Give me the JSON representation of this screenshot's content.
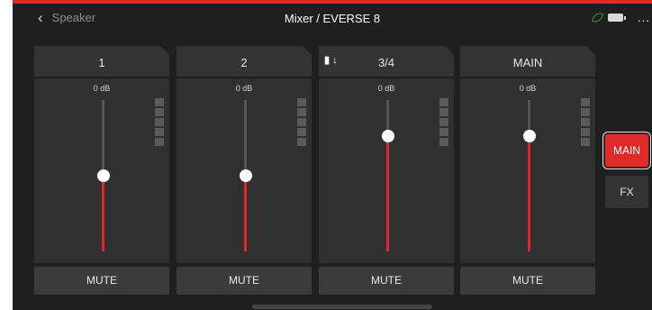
{
  "header": {
    "back_label": "Speaker",
    "title": "Mixer / EVERSE 8",
    "more_label": "..."
  },
  "channels": [
    {
      "label": "1",
      "gain": "0 dB",
      "fader_level": 0.5,
      "mute_label": "MUTE"
    },
    {
      "label": "2",
      "gain": "0 dB",
      "fader_level": 0.5,
      "mute_label": "MUTE"
    },
    {
      "label": "3/4",
      "gain": "0 dB",
      "fader_level": 0.76,
      "mute_label": "MUTE",
      "input_icons": "▮ ↓"
    },
    {
      "label": "MAIN",
      "gain": "0 dB",
      "fader_level": 0.76,
      "mute_label": "MUTE"
    }
  ],
  "side_tabs": [
    {
      "label": "MAIN",
      "active": true
    },
    {
      "label": "FX",
      "active": false
    }
  ],
  "colors": {
    "accent": "#e02a2a",
    "background": "#1f1f1f",
    "panel": "#303030"
  },
  "icons": [
    "chevron-left-icon",
    "eco-leaf-icon",
    "battery-icon",
    "more-icon",
    "input-icon"
  ]
}
